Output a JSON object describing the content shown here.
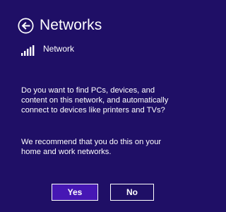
{
  "header": {
    "title": "Networks",
    "back_icon": "back-arrow-circle-icon"
  },
  "network": {
    "name": "Network",
    "icon": "wifi-signal-bars-icon"
  },
  "message": {
    "question": "Do you want to find PCs, devices, and content on this network, and automatically connect to devices like printers and TVs?",
    "recommendation": "We recommend that you do this on your home and work networks."
  },
  "buttons": {
    "yes_label": "Yes",
    "no_label": "No"
  },
  "colors": {
    "background": "#1f0f66",
    "primary_button": "#4617b4",
    "text": "#ffffff"
  }
}
